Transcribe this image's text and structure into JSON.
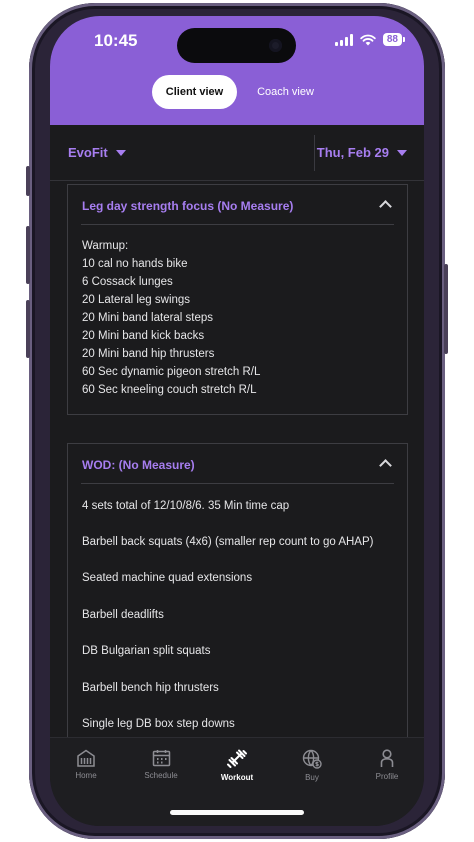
{
  "status_bar": {
    "time": "10:45",
    "battery": "88"
  },
  "view_toggle": {
    "client": "Client view",
    "coach": "Coach view"
  },
  "selectors": {
    "gym": "EvoFit",
    "date": "Thu, Feb 29"
  },
  "warmup_card": {
    "title": "Leg day strength focus (No Measure)",
    "lines": [
      "Warmup:",
      "10 cal no hands bike",
      "6 Cossack lunges",
      "20 Lateral leg swings",
      "20 Mini band lateral steps",
      "20 Mini band kick backs",
      "20 Mini band hip thrusters",
      "60 Sec dynamic pigeon stretch R/L",
      "60 Sec kneeling couch stretch R/L"
    ]
  },
  "wod_card": {
    "title": "WOD: (No Measure)",
    "lines": [
      "4 sets total of 12/10/8/6. 35 Min time cap",
      "Barbell back squats (4x6) (smaller rep count to go AHAP)",
      "Seated machine quad extensions",
      "Barbell deadlifts",
      "DB Bulgarian split squats",
      "Barbell bench hip thrusters",
      "Single leg DB box step downs"
    ]
  },
  "bottom_nav": [
    {
      "label": "Home",
      "icon": "home-icon",
      "active": false
    },
    {
      "label": "Schedule",
      "icon": "calendar-icon",
      "active": false
    },
    {
      "label": "Workout",
      "icon": "dumbbell-icon",
      "active": true
    },
    {
      "label": "Buy",
      "icon": "globe-dollar-icon",
      "active": false
    },
    {
      "label": "Profile",
      "icon": "person-icon",
      "active": false
    }
  ],
  "colors": {
    "accent": "#8a5fd6",
    "accent_text": "#a77ef0",
    "background": "#1b1b1d"
  }
}
